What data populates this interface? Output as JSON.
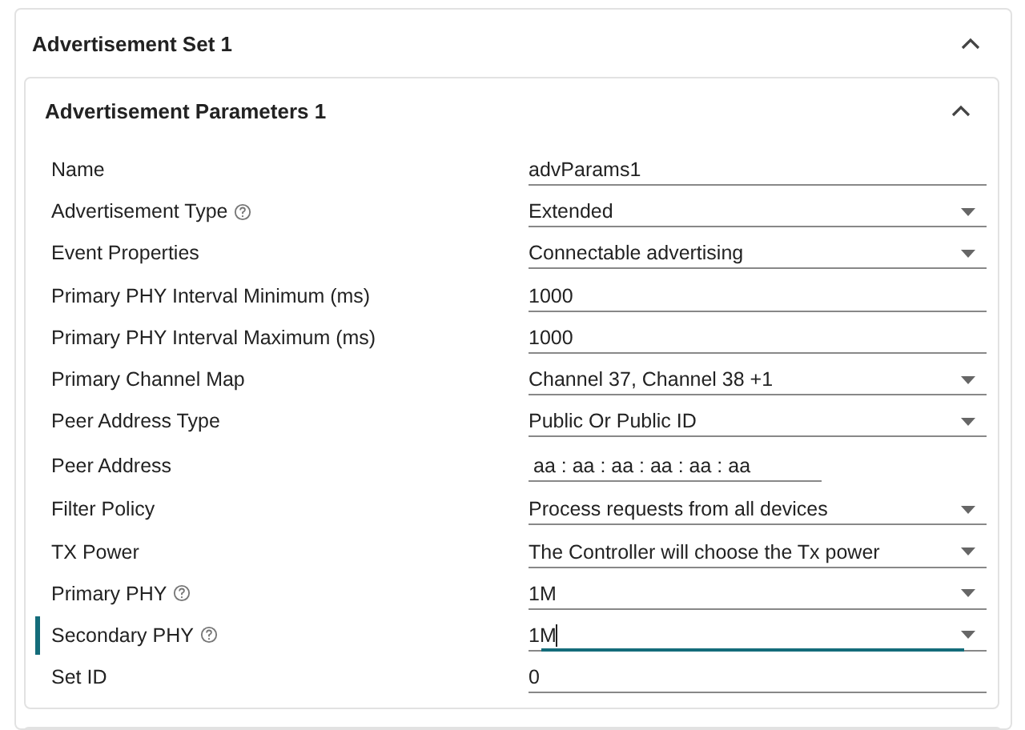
{
  "set": {
    "title": "Advertisement Set 1",
    "expanded": true
  },
  "params": {
    "title": "Advertisement Parameters 1",
    "expanded": true
  },
  "rows": [
    {
      "label": "Name",
      "kind": "text",
      "value": "advParams1",
      "help": false,
      "focused": false
    },
    {
      "label": "Advertisement Type",
      "kind": "select",
      "value": "Extended",
      "help": true,
      "focused": false
    },
    {
      "label": "Event Properties",
      "kind": "select",
      "value": "Connectable advertising",
      "help": false,
      "focused": false
    },
    {
      "label": "Primary PHY Interval Minimum (ms)",
      "kind": "text",
      "value": "1000",
      "help": false,
      "focused": false
    },
    {
      "label": "Primary PHY Interval Maximum (ms)",
      "kind": "text",
      "value": "1000",
      "help": false,
      "focused": false
    },
    {
      "label": "Primary Channel Map",
      "kind": "select",
      "value": "Channel 37, Channel 38 +1",
      "help": false,
      "focused": false
    },
    {
      "label": "Peer Address Type",
      "kind": "select",
      "value": "Public Or Public ID",
      "help": false,
      "focused": false
    },
    {
      "label": "Peer Address",
      "kind": "address",
      "value": "aa : aa : aa : aa : aa : aa",
      "help": false,
      "focused": false
    },
    {
      "label": "Filter Policy",
      "kind": "select",
      "value": "Process requests from all devices",
      "help": false,
      "focused": false
    },
    {
      "label": "TX Power",
      "kind": "select",
      "value": "The Controller will choose the Tx power",
      "help": false,
      "focused": false
    },
    {
      "label": "Primary PHY",
      "kind": "select",
      "value": "1M",
      "help": true,
      "focused": false
    },
    {
      "label": "Secondary PHY",
      "kind": "select",
      "value": "1M",
      "help": true,
      "focused": true
    },
    {
      "label": "Set ID",
      "kind": "text",
      "value": "0",
      "help": false,
      "focused": false
    }
  ]
}
